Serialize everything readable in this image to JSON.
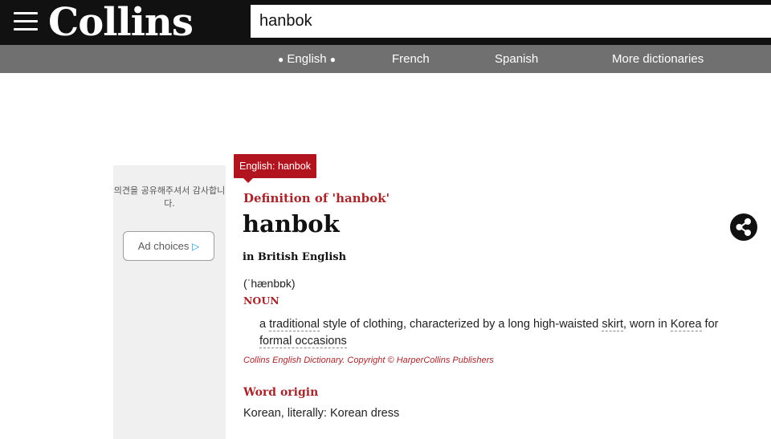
{
  "header": {
    "logo": "Collins",
    "search": {
      "value": "hanbok",
      "placeholder": ""
    }
  },
  "nav": {
    "items": [
      {
        "label": "English",
        "active": true
      },
      {
        "label": "French"
      },
      {
        "label": "Spanish"
      },
      {
        "label": "More dictionaries"
      }
    ]
  },
  "ad": {
    "text": "의견을 공유해주셔서 감사합니다.",
    "choices_label": "Ad choices"
  },
  "entry": {
    "tag": "English: hanbok",
    "definition_title": "Definition of 'hanbok'",
    "headword": "hanbok",
    "region": "in British English",
    "pronunciation": "(ˈhænbɒk)",
    "part_of_speech": "NOUN",
    "definition": {
      "t1": "a ",
      "l1": "traditional",
      "t2": " style of clothing, characterized by a long high-waisted ",
      "l2": "skirt",
      "t3": ", worn in ",
      "l3": "Korea",
      "t4": " for ",
      "l4": "formal occasions"
    },
    "copyright": "Collins English Dictionary. Copyright © HarperCollins Publishers",
    "origin_title": "Word origin",
    "origin_text": "Korean, literally: Korean dress"
  },
  "colors": {
    "accent": "#b1141f",
    "heading": "#a4272b",
    "topbar": "#111111",
    "navbar": "#707070"
  }
}
